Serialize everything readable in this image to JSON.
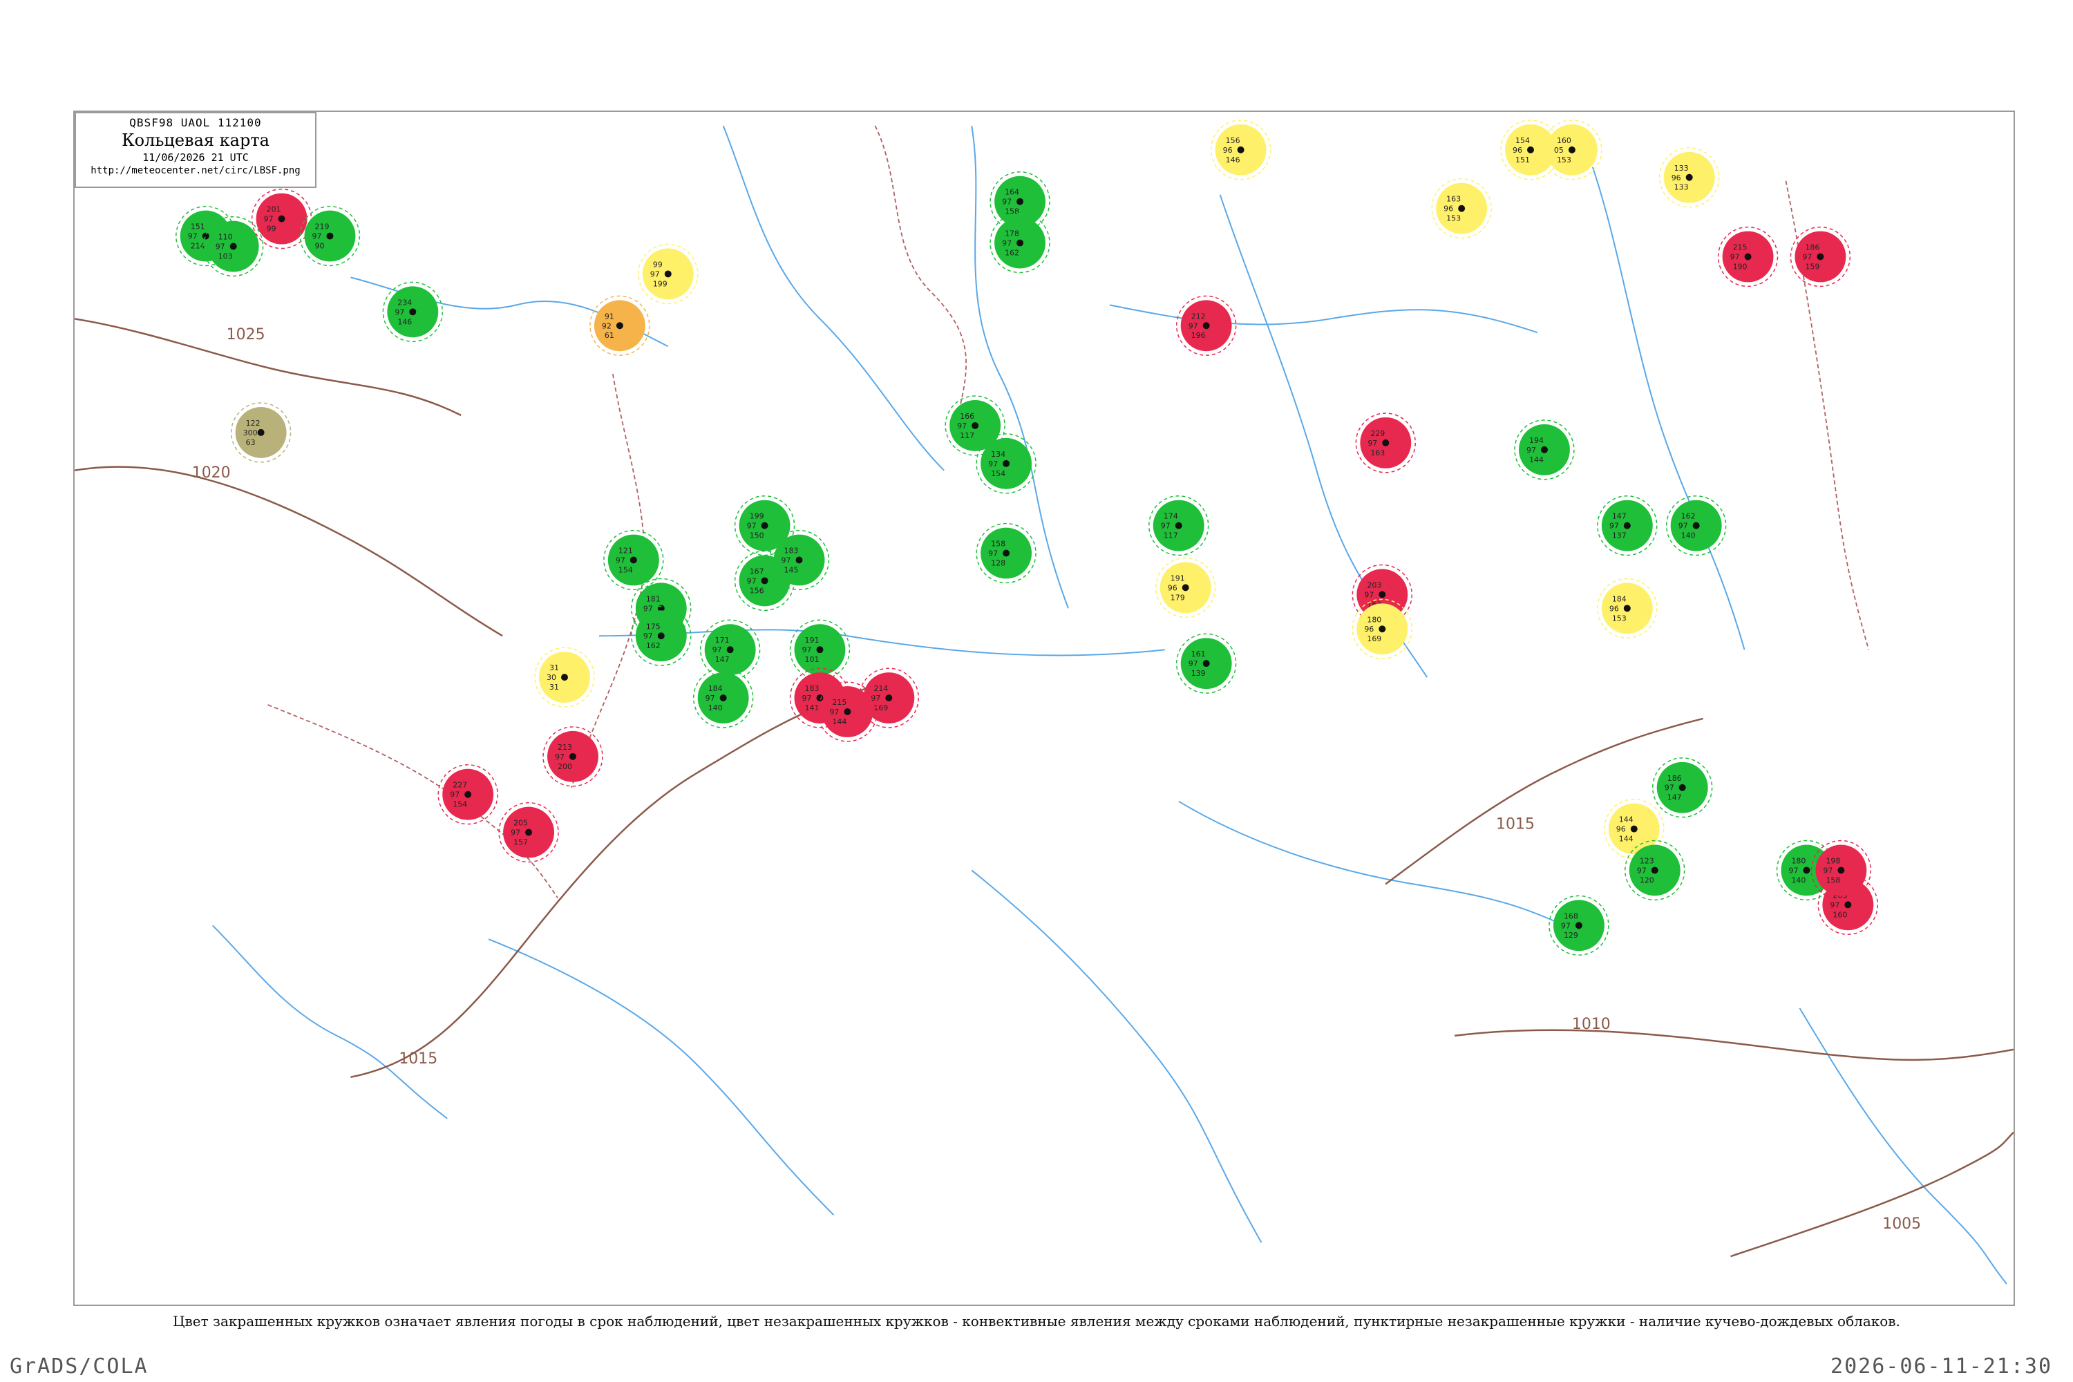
{
  "header": {
    "code": "QBSF98  UAOL  112100",
    "title": "Кольцевая карта",
    "timestamp": "11/06/2026 21 UTC",
    "url": "http://meteocenter.net/circ/LBSF.png"
  },
  "caption": "Цвет закрашенных кружков означает явления погоды в срок наблюдений, цвет незакрашенных кружков - конвективные явления между сроками наблюдений, пунктирные незакрашенные кружки - наличие кучево-дождевых облаков.",
  "footer": {
    "left": "GrADS/COLA",
    "right": "2026-06-11-21:30"
  },
  "colors": {
    "rain": "#1fbf3a",
    "thunder": "#e8294f",
    "fog": "#fff06a",
    "haze": "#f5b34a",
    "dust": "#b8b27a",
    "isobar": "#8b5a4a",
    "river": "#5aa8e8"
  },
  "isobars": [
    {
      "label": "1025",
      "path": "iso1"
    },
    {
      "label": "1020",
      "path": "iso2"
    },
    {
      "label": "1015",
      "path": "iso3"
    },
    {
      "label": "1015",
      "path": "iso4"
    },
    {
      "label": "1010",
      "path": "iso5"
    },
    {
      "label": "1005",
      "path": "iso6"
    }
  ],
  "stations": [
    {
      "kind": "rain",
      "nums": [
        "151",
        "97",
        "214"
      ]
    },
    {
      "kind": "rain",
      "nums": [
        "110",
        "97",
        "103"
      ]
    },
    {
      "kind": "thunder",
      "nums": [
        "201",
        "97",
        "99"
      ]
    },
    {
      "kind": "rain",
      "nums": [
        "219",
        "97",
        "90"
      ]
    },
    {
      "kind": "rain",
      "nums": [
        "234",
        "97",
        "146"
      ]
    },
    {
      "kind": "haze",
      "nums": [
        "91",
        "92",
        "61"
      ]
    },
    {
      "kind": "fog",
      "nums": [
        "99",
        "97",
        "199"
      ]
    },
    {
      "kind": "dust",
      "nums": [
        "122",
        "300",
        "63"
      ]
    },
    {
      "kind": "rain",
      "nums": [
        "164",
        "97",
        "158"
      ]
    },
    {
      "kind": "rain",
      "nums": [
        "178",
        "97",
        "162"
      ]
    },
    {
      "kind": "fog",
      "nums": [
        "156",
        "96",
        "146"
      ]
    },
    {
      "kind": "fog",
      "nums": [
        "154",
        "96",
        "151"
      ]
    },
    {
      "kind": "fog",
      "nums": [
        "160",
        "05",
        "153"
      ]
    },
    {
      "kind": "fog",
      "nums": [
        "163",
        "96",
        "153"
      ]
    },
    {
      "kind": "fog",
      "nums": [
        "133",
        "96",
        "133"
      ]
    },
    {
      "kind": "thunder",
      "nums": [
        "212",
        "97",
        "196"
      ]
    },
    {
      "kind": "thunder",
      "nums": [
        "229",
        "97",
        "163"
      ]
    },
    {
      "kind": "rain",
      "nums": [
        "166",
        "97",
        "117"
      ]
    },
    {
      "kind": "rain",
      "nums": [
        "134",
        "97",
        "154"
      ]
    },
    {
      "kind": "rain",
      "nums": [
        "199",
        "97",
        "150"
      ]
    },
    {
      "kind": "thunder",
      "nums": [
        "215",
        "97",
        "190"
      ]
    },
    {
      "kind": "thunder",
      "nums": [
        "186",
        "97",
        "159"
      ]
    },
    {
      "kind": "rain",
      "nums": [
        "194",
        "97",
        "144"
      ]
    },
    {
      "kind": "rain",
      "nums": [
        "147",
        "97",
        "137"
      ]
    },
    {
      "kind": "rain",
      "nums": [
        "162",
        "97",
        "140"
      ]
    },
    {
      "kind": "fog",
      "nums": [
        "191",
        "96",
        "179"
      ]
    },
    {
      "kind": "thunder",
      "nums": [
        "203",
        "97",
        "163"
      ]
    },
    {
      "kind": "fog",
      "nums": [
        "180",
        "96",
        "169"
      ]
    },
    {
      "kind": "fog",
      "nums": [
        "184",
        "96",
        "153"
      ]
    },
    {
      "kind": "rain",
      "nums": [
        "121",
        "97",
        "154"
      ]
    },
    {
      "kind": "rain",
      "nums": [
        "167",
        "97",
        "156"
      ]
    },
    {
      "kind": "rain",
      "nums": [
        "183",
        "97",
        "145"
      ]
    },
    {
      "kind": "rain",
      "nums": [
        "181",
        "97",
        "150"
      ]
    },
    {
      "kind": "rain",
      "nums": [
        "171",
        "97",
        "147"
      ]
    },
    {
      "kind": "rain",
      "nums": [
        "175",
        "97",
        "162"
      ]
    },
    {
      "kind": "rain",
      "nums": [
        "184",
        "97",
        "140"
      ]
    },
    {
      "kind": "rain",
      "nums": [
        "158",
        "97",
        "128"
      ]
    },
    {
      "kind": "rain",
      "nums": [
        "174",
        "97",
        "117"
      ]
    },
    {
      "kind": "rain",
      "nums": [
        "191",
        "97",
        "101"
      ]
    },
    {
      "kind": "fog",
      "nums": [
        "31",
        "30",
        "31"
      ]
    },
    {
      "kind": "thunder",
      "nums": [
        "213",
        "97",
        "200"
      ]
    },
    {
      "kind": "thunder",
      "nums": [
        "183",
        "97",
        "141"
      ]
    },
    {
      "kind": "thunder",
      "nums": [
        "214",
        "97",
        "169"
      ]
    },
    {
      "kind": "thunder",
      "nums": [
        "215",
        "97",
        "144"
      ]
    },
    {
      "kind": "thunder",
      "nums": [
        "227",
        "97",
        "154"
      ]
    },
    {
      "kind": "thunder",
      "nums": [
        "205",
        "97",
        "157"
      ]
    },
    {
      "kind": "rain",
      "nums": [
        "186",
        "97",
        "147"
      ]
    },
    {
      "kind": "rain",
      "nums": [
        "168",
        "97",
        "129"
      ]
    },
    {
      "kind": "fog",
      "nums": [
        "144",
        "96",
        "144"
      ]
    },
    {
      "kind": "rain",
      "nums": [
        "123",
        "97",
        "120"
      ]
    },
    {
      "kind": "rain",
      "nums": [
        "180",
        "97",
        "140"
      ]
    },
    {
      "kind": "thunder",
      "nums": [
        "203",
        "97",
        "160"
      ]
    },
    {
      "kind": "thunder",
      "nums": [
        "198",
        "97",
        "158"
      ]
    },
    {
      "kind": "rain",
      "nums": [
        "161",
        "97",
        "139"
      ]
    }
  ]
}
